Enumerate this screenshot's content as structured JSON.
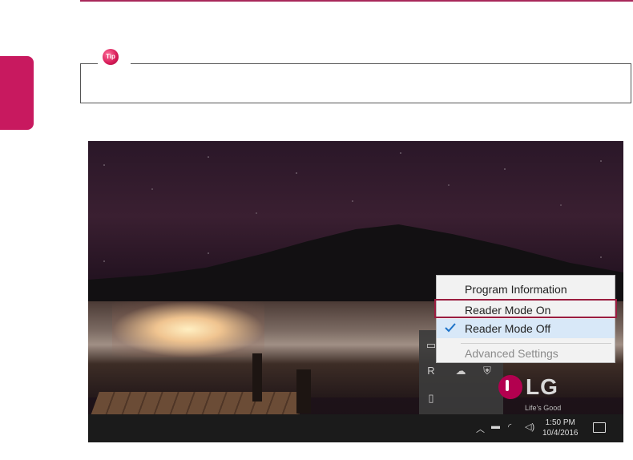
{
  "tip": {
    "badge": "Tip"
  },
  "menu": {
    "items": [
      {
        "label": "Program Information"
      },
      {
        "label": "Reader Mode On"
      },
      {
        "label": "Reader Mode Off"
      },
      {
        "label": "Advanced Settings"
      }
    ]
  },
  "desktop": {
    "brand": "LG",
    "tagline": "Life's Good"
  },
  "taskbar": {
    "time": "1:50 PM",
    "date": "10/4/2016"
  },
  "icons": [
    "chevron-up-icon",
    "battery-icon",
    "wifi-icon",
    "speaker-icon",
    "notification-icon",
    "monitor-icon",
    "cloud-icon",
    "shield-icon",
    "usb-icon",
    "check-icon"
  ]
}
